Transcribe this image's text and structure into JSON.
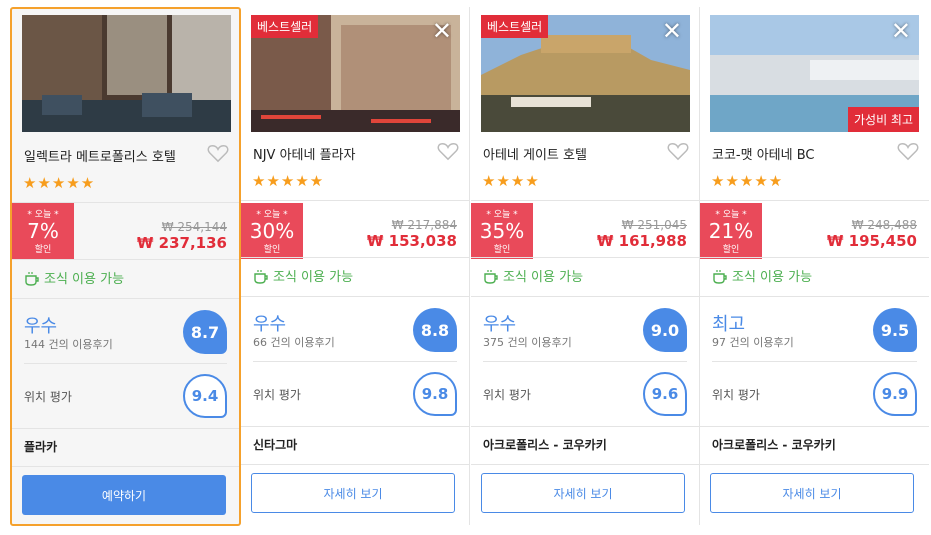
{
  "cards": [
    {
      "name": "일렉트라 메트로폴리스 호텔",
      "stars": "★★★★★",
      "best_badge": "",
      "value_badge": "",
      "deal_today": "* 오늘 *",
      "deal_pct": "7%",
      "deal_off": "할인",
      "old_price": "₩ 254,144",
      "new_price": "₩ 237,136",
      "breakfast": "조식 이용 가능",
      "rating_word": "우수",
      "review_count": "144 건의 이용후기",
      "score": "8.7",
      "loc_label": "위치 평가",
      "loc_score": "9.4",
      "area": "플라카",
      "button": "예약하기",
      "photo_colors": [
        "#5c4a3c",
        "#8a7a66",
        "#2e3b45"
      ]
    },
    {
      "name": "NJV 아테네 플라자",
      "stars": "★★★★★",
      "best_badge": "베스트셀러",
      "value_badge": "",
      "deal_today": "* 오늘 *",
      "deal_pct": "30%",
      "deal_off": "할인",
      "old_price": "₩ 217,884",
      "new_price": "₩ 153,038",
      "breakfast": "조식 이용 가능",
      "rating_word": "우수",
      "review_count": "66 건의 이용후기",
      "score": "8.8",
      "loc_label": "위치 평가",
      "loc_score": "9.8",
      "area": "신타그마",
      "button": "자세히 보기",
      "photo_colors": [
        "#7a5a4a",
        "#c9b39a",
        "#3a2a2a"
      ]
    },
    {
      "name": "아테네 게이트 호텔",
      "stars": "★★★★",
      "best_badge": "베스트셀러",
      "value_badge": "",
      "deal_today": "* 오늘 *",
      "deal_pct": "35%",
      "deal_off": "할인",
      "old_price": "₩ 251,045",
      "new_price": "₩ 161,988",
      "breakfast": "조식 이용 가능",
      "rating_word": "우수",
      "review_count": "375 건의 이용후기",
      "score": "9.0",
      "loc_label": "위치 평가",
      "loc_score": "9.6",
      "area": "아크로폴리스 - 코우카키",
      "button": "자세히 보기",
      "photo_colors": [
        "#8fb3d9",
        "#c9a56a",
        "#4a4a3a"
      ]
    },
    {
      "name": "코코-맷 아테네 BC",
      "stars": "★★★★★",
      "best_badge": "",
      "value_badge": "가성비 최고",
      "deal_today": "* 오늘 *",
      "deal_pct": "21%",
      "deal_off": "할인",
      "old_price": "₩ 248,488",
      "new_price": "₩ 195,450",
      "breakfast": "조식 이용 가능",
      "rating_word": "최고",
      "review_count": "97 건의 이용후기",
      "score": "9.5",
      "loc_label": "위치 평가",
      "loc_score": "9.9",
      "area": "아크로폴리스 - 코우카키",
      "button": "자세히 보기",
      "photo_colors": [
        "#a9c8e6",
        "#d8dde2",
        "#6fa6c7"
      ]
    }
  ],
  "close_glyph": "✕"
}
